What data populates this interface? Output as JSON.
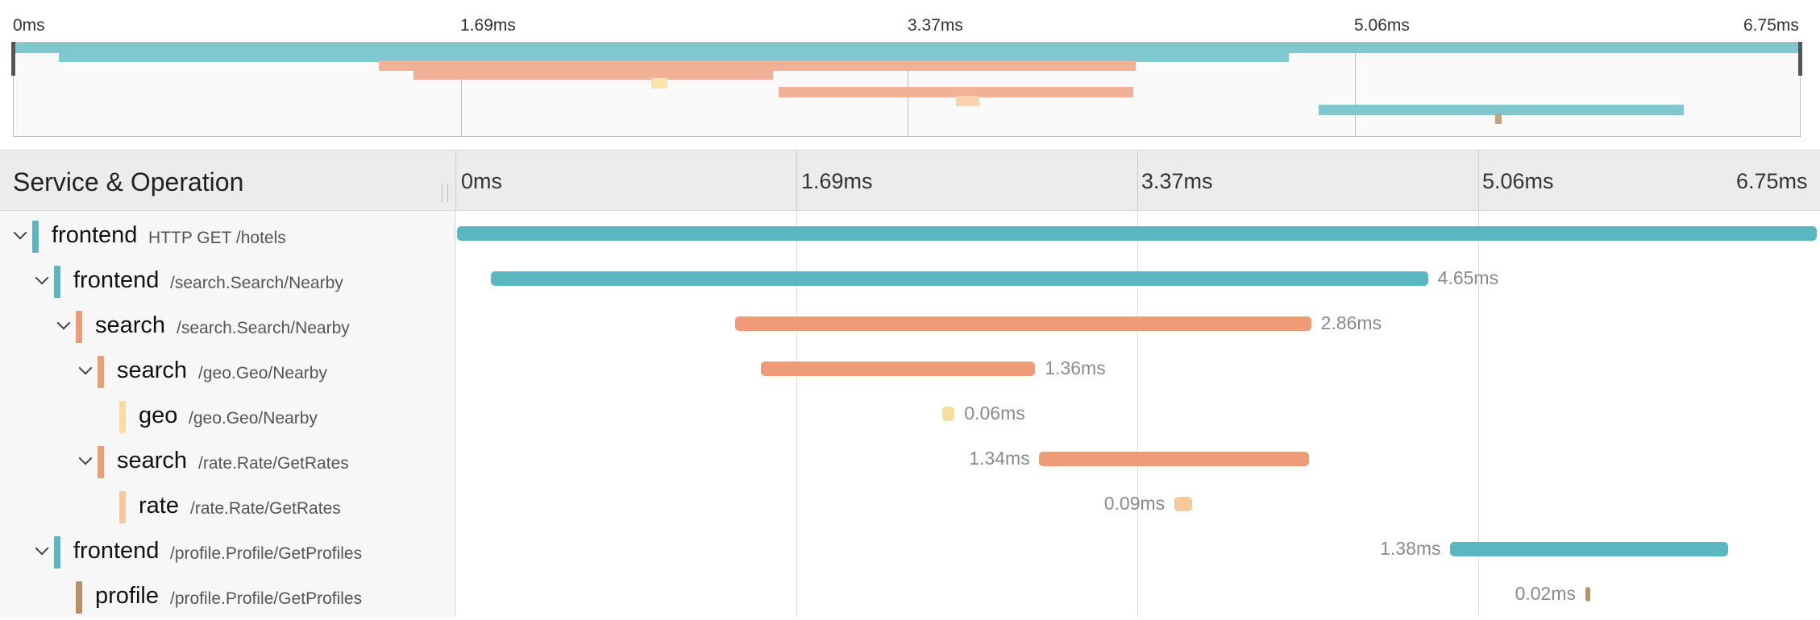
{
  "colors": {
    "frontend": "#5bb6bf",
    "search": "#ee9b77",
    "geo": "#f6dea0",
    "rate": "#f7c89b",
    "profile": "#b99068",
    "minimap_frontend": "#7ec8ce",
    "minimap_search": "#f0b197",
    "minimap_geo": "#f7e3b0",
    "minimap_rate": "#f8d3ae",
    "minimap_profile": "#c4a27e"
  },
  "minimap": {
    "tick_labels": [
      "0ms",
      "1.69ms",
      "3.37ms",
      "5.06ms",
      "6.75ms"
    ]
  },
  "header": {
    "title": "Service & Operation",
    "tick_labels": [
      "0ms",
      "1.69ms",
      "3.37ms",
      "5.06ms",
      "6.75ms"
    ]
  },
  "trace": {
    "total_ms": 6.75,
    "spans": [
      {
        "service": "frontend",
        "operation": "HTTP GET /hotels",
        "start_ms": 0.0,
        "duration_ms": 6.75,
        "duration_label": "",
        "depth": 0,
        "collapsible": true,
        "label_side": "right"
      },
      {
        "service": "frontend",
        "operation": "/search.Search/Nearby",
        "start_ms": 0.17,
        "duration_ms": 4.65,
        "duration_label": "4.65ms",
        "depth": 1,
        "collapsible": true,
        "label_side": "right"
      },
      {
        "service": "search",
        "operation": "/search.Search/Nearby",
        "start_ms": 1.38,
        "duration_ms": 2.86,
        "duration_label": "2.86ms",
        "depth": 2,
        "collapsible": true,
        "label_side": "right"
      },
      {
        "service": "search",
        "operation": "/geo.Geo/Nearby",
        "start_ms": 1.51,
        "duration_ms": 1.36,
        "duration_label": "1.36ms",
        "depth": 3,
        "collapsible": true,
        "label_side": "right"
      },
      {
        "service": "geo",
        "operation": "/geo.Geo/Nearby",
        "start_ms": 2.41,
        "duration_ms": 0.06,
        "duration_label": "0.06ms",
        "depth": 4,
        "collapsible": false,
        "label_side": "right"
      },
      {
        "service": "search",
        "operation": "/rate.Rate/GetRates",
        "start_ms": 2.89,
        "duration_ms": 1.34,
        "duration_label": "1.34ms",
        "depth": 3,
        "collapsible": true,
        "label_side": "left"
      },
      {
        "service": "rate",
        "operation": "/rate.Rate/GetRates",
        "start_ms": 3.56,
        "duration_ms": 0.09,
        "duration_label": "0.09ms",
        "depth": 4,
        "collapsible": false,
        "label_side": "left"
      },
      {
        "service": "frontend",
        "operation": "/profile.Profile/GetProfiles",
        "start_ms": 4.93,
        "duration_ms": 1.38,
        "duration_label": "1.38ms",
        "depth": 1,
        "collapsible": true,
        "label_side": "left"
      },
      {
        "service": "profile",
        "operation": "/profile.Profile/GetProfiles",
        "start_ms": 5.6,
        "duration_ms": 0.02,
        "duration_label": "0.02ms",
        "depth": 2,
        "collapsible": false,
        "label_side": "left"
      }
    ]
  }
}
